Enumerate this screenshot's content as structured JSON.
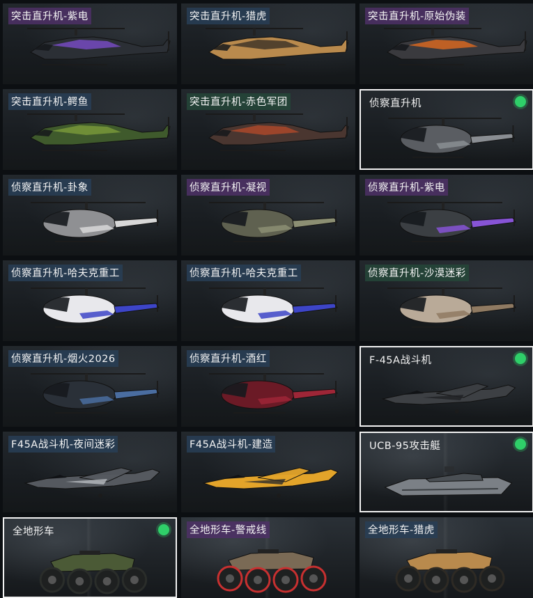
{
  "items": [
    {
      "name": "突击直升机-紫电",
      "tint": "purple",
      "art": "attack-heli",
      "body": "#2b2f35",
      "accent": "#7a4cc9",
      "selected": false
    },
    {
      "name": "突击直升机-猎虎",
      "tint": "blue",
      "art": "attack-heli",
      "body": "#b98a4d",
      "accent": "#3a3026",
      "selected": false
    },
    {
      "name": "突击直升机-原始伪装",
      "tint": "purple",
      "art": "attack-heli",
      "body": "#3a3a3e",
      "accent": "#e06a1f",
      "selected": false
    },
    {
      "name": "突击直升机-鳄鱼",
      "tint": "blue",
      "art": "attack-heli",
      "body": "#3f5a2c",
      "accent": "#7c9b3b",
      "selected": false
    },
    {
      "name": "突击直升机-赤色军团",
      "tint": "green",
      "art": "attack-heli",
      "body": "#4a3630",
      "accent": "#b04a2a",
      "selected": false
    },
    {
      "name": "侦察直升机",
      "tint": "none",
      "art": "scout-heli",
      "body": "#5a5d62",
      "accent": "#8a8e93",
      "selected": true
    },
    {
      "name": "侦察直升机-卦象",
      "tint": "blue",
      "art": "scout-heli",
      "body": "#8f9093",
      "accent": "#d8d8d8",
      "selected": false
    },
    {
      "name": "侦察直升机-凝视",
      "tint": "purple",
      "art": "scout-heli",
      "body": "#5f6150",
      "accent": "#8c8f73",
      "selected": false
    },
    {
      "name": "侦察直升机-紫电",
      "tint": "purple",
      "art": "scout-heli",
      "body": "#3b3f43",
      "accent": "#8754d6",
      "selected": false
    },
    {
      "name": "侦察直升机-哈夫克重工",
      "tint": "blue",
      "art": "scout-heli",
      "body": "#e8e8ec",
      "accent": "#3d45c8",
      "selected": false
    },
    {
      "name": "侦察直升机-哈夫克重工",
      "tint": "blue",
      "art": "scout-heli",
      "body": "#e8e8ec",
      "accent": "#3d45c8",
      "selected": false
    },
    {
      "name": "侦察直升机-沙漠迷彩",
      "tint": "green",
      "art": "scout-heli",
      "body": "#b9aa98",
      "accent": "#8f7a62",
      "selected": false
    },
    {
      "name": "侦察直升机-烟火2026",
      "tint": "blue",
      "art": "scout-heli",
      "body": "#2a3038",
      "accent": "#4a6da0",
      "selected": false
    },
    {
      "name": "侦察直升机-酒红",
      "tint": "blue",
      "art": "scout-heli",
      "body": "#6b1a26",
      "accent": "#9e2637",
      "selected": false
    },
    {
      "name": "F-45A战斗机",
      "tint": "none",
      "art": "jet",
      "body": "#3d4044",
      "accent": "#1f2124",
      "selected": true
    },
    {
      "name": "F45A战斗机-夜间迷彩",
      "tint": "blue",
      "art": "jet",
      "body": "#55595f",
      "accent": "#b8bcc0",
      "selected": false
    },
    {
      "name": "F45A战斗机-建造",
      "tint": "blue",
      "art": "jet",
      "body": "#e3a42a",
      "accent": "#2a2a2a",
      "selected": false
    },
    {
      "name": "UCB-95攻击艇",
      "tint": "none",
      "art": "boat",
      "body": "#7b8086",
      "accent": "#4a4f54",
      "selected": true
    },
    {
      "name": "全地形车",
      "tint": "none",
      "art": "atv",
      "body": "#4b5a36",
      "accent": "#2a2d2a",
      "selected": true
    },
    {
      "name": "全地形车-警戒线",
      "tint": "purple",
      "art": "atv",
      "body": "#7a6a55",
      "accent": "#c83030",
      "selected": false
    },
    {
      "name": "全地形车-猎虎",
      "tint": "blue",
      "art": "atv",
      "body": "#b98a4d",
      "accent": "#2e2a24",
      "selected": false
    }
  ]
}
